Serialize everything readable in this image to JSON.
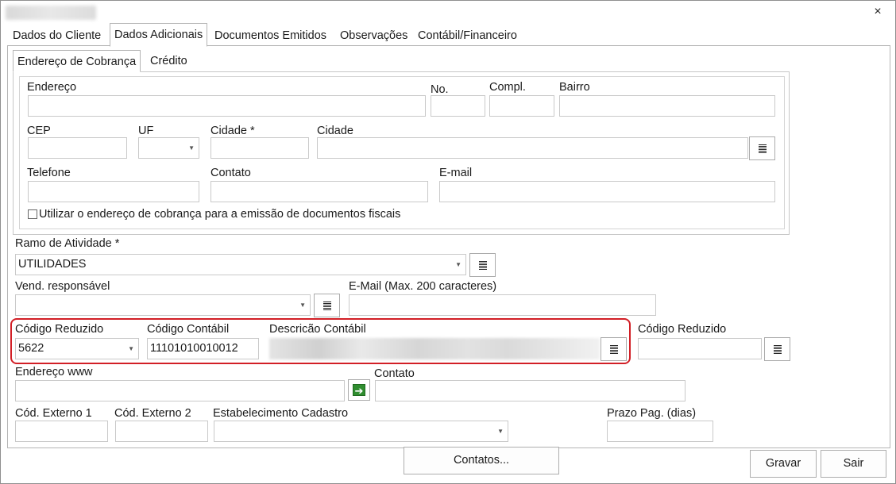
{
  "window": {
    "close_glyph": "×"
  },
  "tabs": [
    {
      "label": "Dados do Cliente"
    },
    {
      "label": "Dados Adicionais"
    },
    {
      "label": "Documentos Emitidos"
    },
    {
      "label": "Observações"
    },
    {
      "label": "Contábil/Financeiro"
    }
  ],
  "subtabs": [
    {
      "label": "Endereço de Cobrança"
    },
    {
      "label": "Crédito"
    }
  ],
  "billing": {
    "endereco_label": "Endereço",
    "endereco_value": "",
    "numero_label": "No.",
    "numero_value": "",
    "compl_label": "Compl.",
    "compl_value": "",
    "bairro_label": "Bairro",
    "bairro_value": "",
    "cep_label": "CEP",
    "cep_value": "",
    "uf_label": "UF",
    "uf_value": "",
    "cidade_req_label": "Cidade *",
    "cidade_req_value": "",
    "cidade_label": "Cidade",
    "cidade_value": "",
    "telefone_label": "Telefone",
    "telefone_value": "",
    "contato_label": "Contato",
    "contato_value": "",
    "email_label": "E-mail",
    "email_value": "",
    "use_billing_checked": false,
    "use_billing_label": "Utilizar o endereço de cobrança  para a emissão de documentos fiscais"
  },
  "form": {
    "ramo_label": "Ramo de Atividade *",
    "ramo_value": "UTILIDADES",
    "vend_label": "Vend. responsável",
    "vend_value": "",
    "email200_label": "E-Mail (Max. 200 caracteres)",
    "email200_value": "",
    "cod_reduzido_label": "Código Reduzido",
    "cod_reduzido_value": "5622",
    "cod_contabil_label": "Código Contábil",
    "cod_contabil_value": "11101010010012",
    "desc_contabil_label": "Descricão Contábil",
    "cod_reduzido2_label": "Código Reduzido",
    "cod_reduzido2_value": "",
    "endereco_www_label": "Endereço www",
    "endereco_www_value": "",
    "contato2_label": "Contato",
    "contato2_value": "",
    "cod_ext1_label": "Cód. Externo 1",
    "cod_ext1_value": "",
    "cod_ext2_label": "Cód. Externo 2",
    "cod_ext2_value": "",
    "estab_label": "Estabelecimento Cadastro",
    "estab_value": "",
    "prazo_label": "Prazo Pag. (dias)",
    "prazo_value": ""
  },
  "buttons": {
    "contatos": "Contatos...",
    "gravar": "Gravar",
    "sair": "Sair"
  },
  "icons": {
    "list": "list-icon",
    "go": "green-arrow-icon",
    "dropdown": "chevron-down-icon"
  },
  "colors": {
    "highlight_border": "#d21f26",
    "go_icon": "#2f8d2f"
  }
}
